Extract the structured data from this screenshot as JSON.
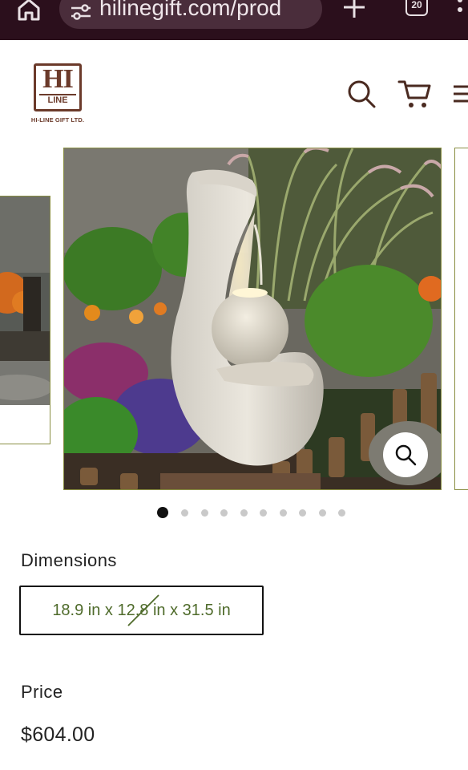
{
  "browser": {
    "url": "hilinegift.com/prod",
    "tab_count": "20"
  },
  "header": {
    "logo_mark": "HI",
    "logo_word": "LINE",
    "logo_subtitle": "HI-LINE GIFT LTD."
  },
  "gallery": {
    "slide_count": 10,
    "active_slide": 1
  },
  "product": {
    "dimensions_label": "Dimensions",
    "dimension_option": "18.9 in x 12.8 in x 31.5 in",
    "dimension_option_unavailable": true,
    "price_label": "Price",
    "price_value": "$604.00"
  },
  "colors": {
    "browser_bar": "#2b0f1c",
    "brand_brown": "#6b3a2a",
    "option_text_green": "#4f6b2b",
    "slide_border": "#8a8f44"
  },
  "icons": [
    "home-icon",
    "tune-icon",
    "plus-icon",
    "tabs-icon",
    "more-icon",
    "search-icon",
    "cart-icon",
    "hamburger-menu-icon",
    "zoom-icon"
  ]
}
